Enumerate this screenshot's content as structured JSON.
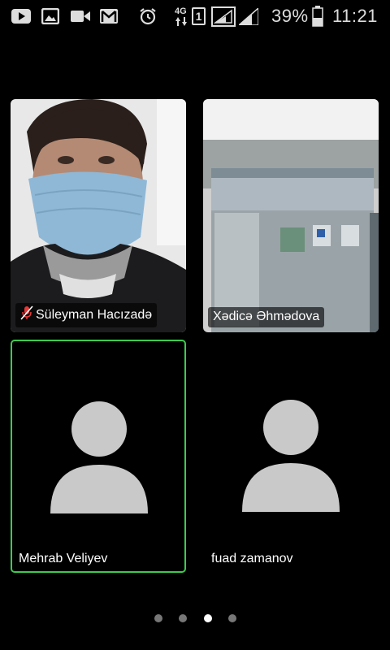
{
  "status_bar": {
    "icons": [
      "youtube-icon",
      "gallery-icon",
      "video-camera-icon",
      "gmail-icon",
      "alarm-icon",
      "4g-signal-icon",
      "sim-icon",
      "signal-bars-icon",
      "signal-bars-icon",
      "battery-icon"
    ],
    "network_type": "4G",
    "sim_slot": "1",
    "battery": "39%",
    "time": "11:21"
  },
  "participants": [
    {
      "name": "Süleyman Hacızadə",
      "muted": true,
      "video": true,
      "active_speaker": false
    },
    {
      "name": "Xədicə Əhmədova",
      "muted": false,
      "video": true,
      "active_speaker": false
    },
    {
      "name": "Mehrab Veliyev",
      "muted": false,
      "video": false,
      "active_speaker": true
    },
    {
      "name": "fuad zamanov",
      "muted": false,
      "video": false,
      "active_speaker": false
    }
  ],
  "pager": {
    "pages": 4,
    "current_page": 3
  },
  "colors": {
    "active_speaker_border": "#3ccc4e",
    "avatar_fill": "#c9c9c9",
    "muted_icon": "#e53935"
  }
}
